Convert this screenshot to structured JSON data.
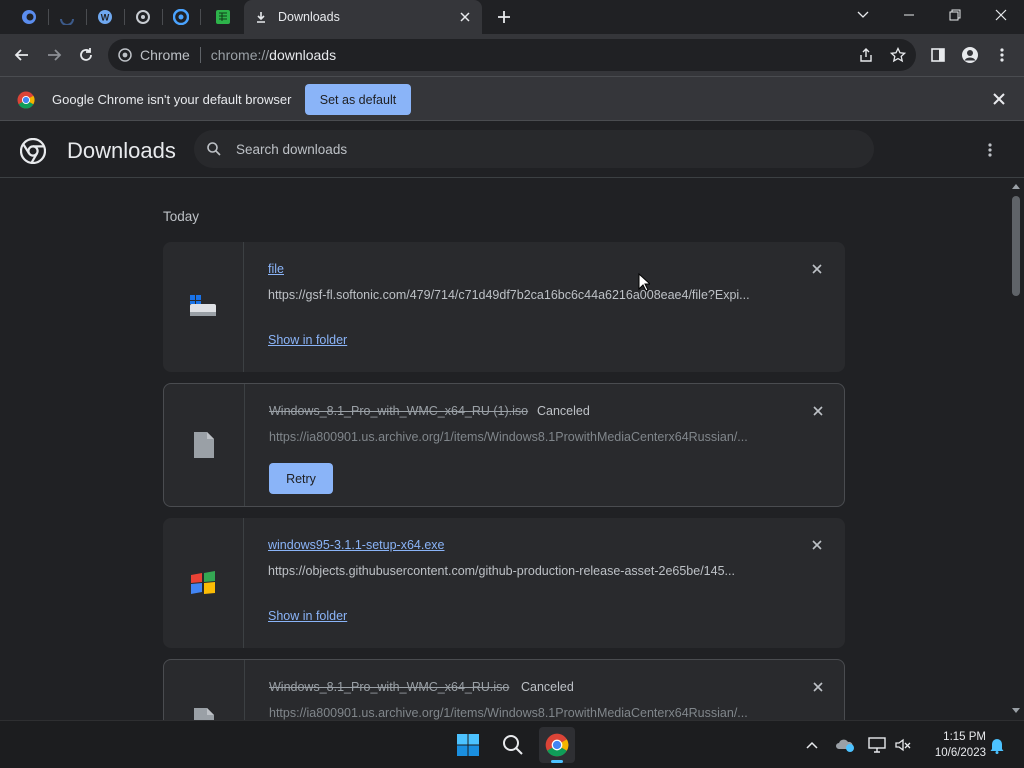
{
  "tabs": {
    "pinned": [
      {
        "name": "pinned-tab-1",
        "color": "#5b8def"
      },
      {
        "name": "pinned-tab-2",
        "color": "#3c5a8a"
      },
      {
        "name": "pinned-tab-3",
        "color": "#6fa8f0"
      },
      {
        "name": "pinned-tab-4",
        "color": "#c8ccd2"
      },
      {
        "name": "pinned-tab-5",
        "color": "#4aa3ff"
      },
      {
        "name": "pinned-tab-6",
        "color": "#2db34a"
      }
    ],
    "active": {
      "label": "Downloads"
    }
  },
  "omnibox": {
    "site_label": "Chrome",
    "url_scheme": "chrome://",
    "url_host": "downloads"
  },
  "infobar": {
    "message": "Google Chrome isn't your default browser",
    "button_label": "Set as default"
  },
  "downloads": {
    "title": "Downloads",
    "search_placeholder": "Search downloads",
    "date_heading": "Today",
    "items": [
      {
        "name": "file",
        "url": "https://gsf-fl.softonic.com/479/714/c71d49df7b2ca16bc6c44a6216a008eae4/file?Expi...",
        "action": "Show in folder",
        "status": ""
      },
      {
        "name": "Windows_8.1_Pro_with_WMC_x64_RU (1).iso",
        "url": "https://ia800901.us.archive.org/1/items/Windows8.1ProwithMediaCenterx64Russian/...",
        "action": "Retry",
        "status": "Canceled"
      },
      {
        "name": "windows95-3.1.1-setup-x64.exe",
        "url": "https://objects.githubusercontent.com/github-production-release-asset-2e65be/145...",
        "action": "Show in folder",
        "status": ""
      },
      {
        "name": "Windows_8.1_Pro_with_WMC_x64_RU.iso",
        "url": "https://ia800901.us.archive.org/1/items/Windows8.1ProwithMediaCenterx64Russian/...",
        "action": "",
        "status": "Canceled"
      }
    ]
  },
  "taskbar": {
    "time": "1:15 PM",
    "date": "10/6/2023"
  },
  "colors": {
    "accent": "#8ab4f8",
    "background": "#202124",
    "toolbar": "#35363a",
    "card": "#292a2d"
  }
}
